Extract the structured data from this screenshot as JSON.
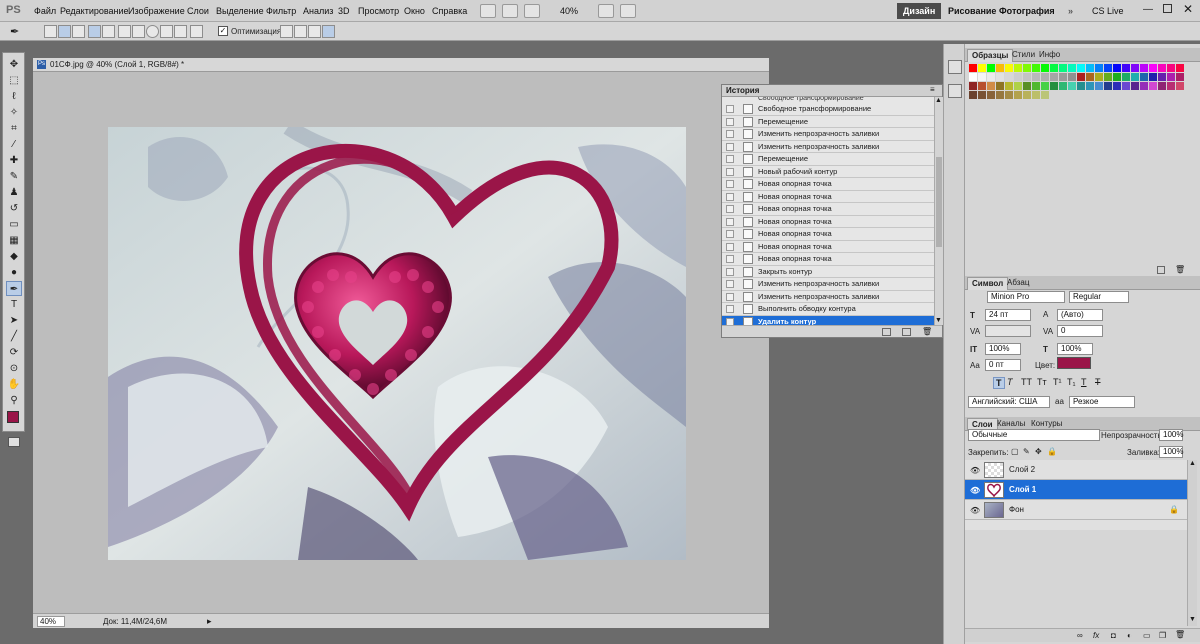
{
  "app": {
    "logo": "PS"
  },
  "menu": [
    "Файл",
    "Редактирование",
    "Изображение",
    "Слои",
    "Выделение",
    "Фильтр",
    "Анализ",
    "3D",
    "Просмотр",
    "Окно",
    "Справка"
  ],
  "top_zoom": "40%",
  "workspaces": {
    "active": "Дизайн",
    "items": [
      "Рисование",
      "Фотография"
    ],
    "cslive": "CS Live"
  },
  "options": {
    "optimize_label": "Оптимизация"
  },
  "document": {
    "tab_title": "01СФ.jpg @ 40% (Слой 1, RGB/8#) *",
    "zoom": "40%",
    "doc_info": "Док: 11,4M/24,6M"
  },
  "history": {
    "title": "История",
    "partial_top": "Свободное трансформирование",
    "items": [
      "Свободное трансформирование",
      "Перемещение",
      "Изменить непрозрачность заливки",
      "Изменить непрозрачность заливки",
      "Перемещение",
      "Новый рабочий контур",
      "Новая опорная точка",
      "Новая опорная точка",
      "Новая опорная точка",
      "Новая опорная точка",
      "Новая опорная точка",
      "Новая опорная точка",
      "Новая опорная точка",
      "Закрыть контур",
      "Изменить непрозрачность заливки",
      "Изменить непрозрачность заливки",
      "Выполнить обводку контура",
      "Удалить контур"
    ],
    "selected_index": 17
  },
  "swatches_panel": {
    "tabs": [
      "Образцы",
      "Стили",
      "Инфо"
    ]
  },
  "character_panel": {
    "tabs": [
      "Символ",
      "Абзац"
    ],
    "font_family": "Minion Pro",
    "font_style": "Regular",
    "size": "24 пт",
    "leading": "(Авто)",
    "tracking": "0",
    "vscale": "100%",
    "hscale": "100%",
    "baseline": "0 пт",
    "color_label": "Цвет:",
    "color": "#9a1548",
    "language": "Английский: США",
    "aa_label": "aa",
    "antialias": "Резкое"
  },
  "layers_panel": {
    "tabs": [
      "Слои",
      "Каналы",
      "Контуры"
    ],
    "blend_mode": "Обычные",
    "opacity_label": "Непрозрачность:",
    "opacity": "100%",
    "lock_label": "Закрепить:",
    "fill_label": "Заливка:",
    "fill": "100%",
    "layers": [
      {
        "name": "Слой 2",
        "selected": false
      },
      {
        "name": "Слой 1",
        "selected": true
      },
      {
        "name": "Фон",
        "selected": false
      }
    ]
  },
  "colors": {
    "heart": "#9a1548",
    "selection": "#1e6dd6"
  }
}
